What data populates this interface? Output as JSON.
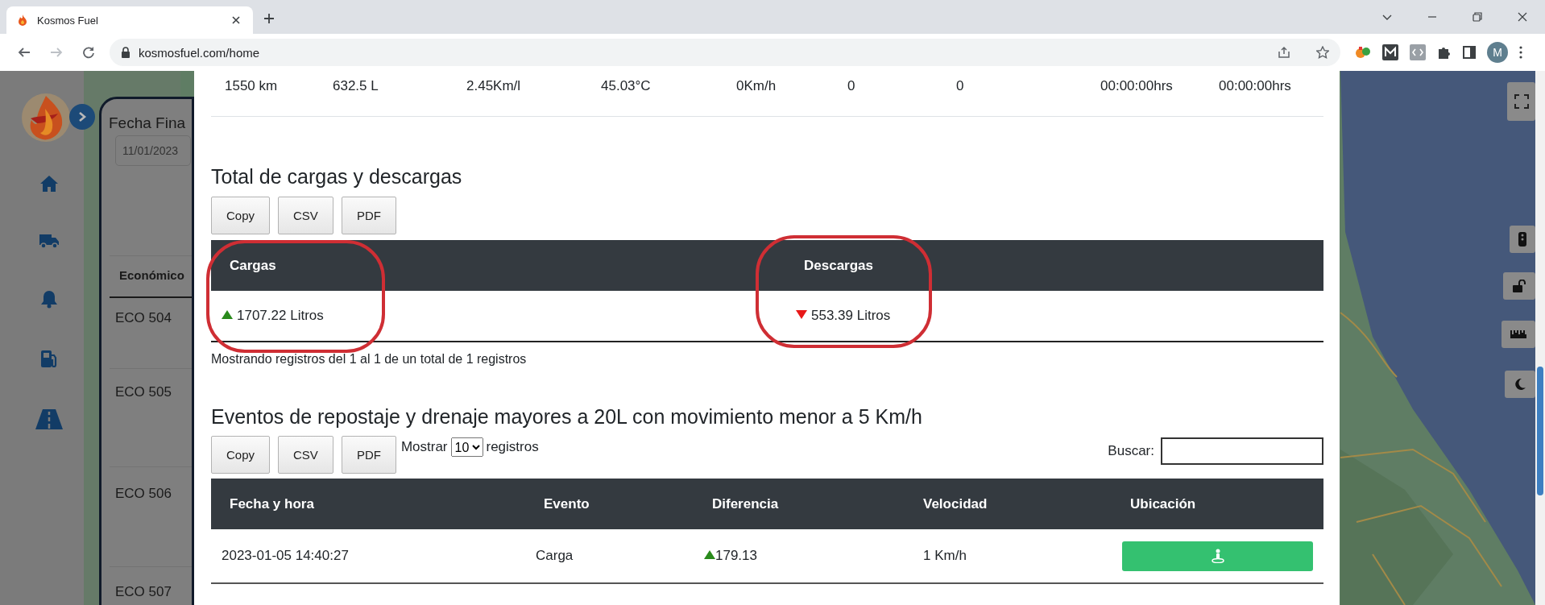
{
  "browser": {
    "tab_title": "Kosmos Fuel",
    "url": "kosmosfuel.com/home",
    "profile_initial": "M"
  },
  "background_panel": {
    "date_label": "Fecha Fina",
    "date_value": "11/01/2023",
    "column_header": "Económico",
    "rows": [
      "ECO 504",
      "ECO 505",
      "ECO 506",
      "ECO 507"
    ]
  },
  "modal": {
    "summary_row": [
      "1550 km",
      "632.5 L",
      "2.45Km/l",
      "45.03°C",
      "0Km/h",
      "0",
      "0",
      "00:00:00hrs",
      "00:00:00hrs"
    ],
    "totals": {
      "title": "Total de cargas y descargas",
      "buttons": [
        "Copy",
        "CSV",
        "PDF"
      ],
      "columns": [
        "Cargas",
        "Descargas"
      ],
      "values": [
        {
          "increase": true,
          "text": "1707.22 Litros",
          "highlighted": true
        },
        {
          "increase": false,
          "text": "553.39 Litros",
          "highlighted": true
        }
      ],
      "info": "Mostrando registros del 1 al 1 de un total de 1 registros"
    },
    "events": {
      "title": "Eventos de repostaje y drenaje mayores a 20L con movimiento menor a 5 Km/h",
      "buttons": [
        "Copy",
        "CSV",
        "PDF"
      ],
      "length_label": "Mostrar",
      "length_value": "10",
      "length_suffix": "registros",
      "search_label": "Buscar:",
      "columns": [
        "Fecha y hora",
        "Evento",
        "Diferencia",
        "Velocidad",
        "Ubicación"
      ],
      "rows": [
        {
          "datetime": "2023-01-05 14:40:27",
          "event": "Carga",
          "increase": true,
          "difference": "179.13",
          "speed": "1 Km/h"
        }
      ]
    }
  }
}
